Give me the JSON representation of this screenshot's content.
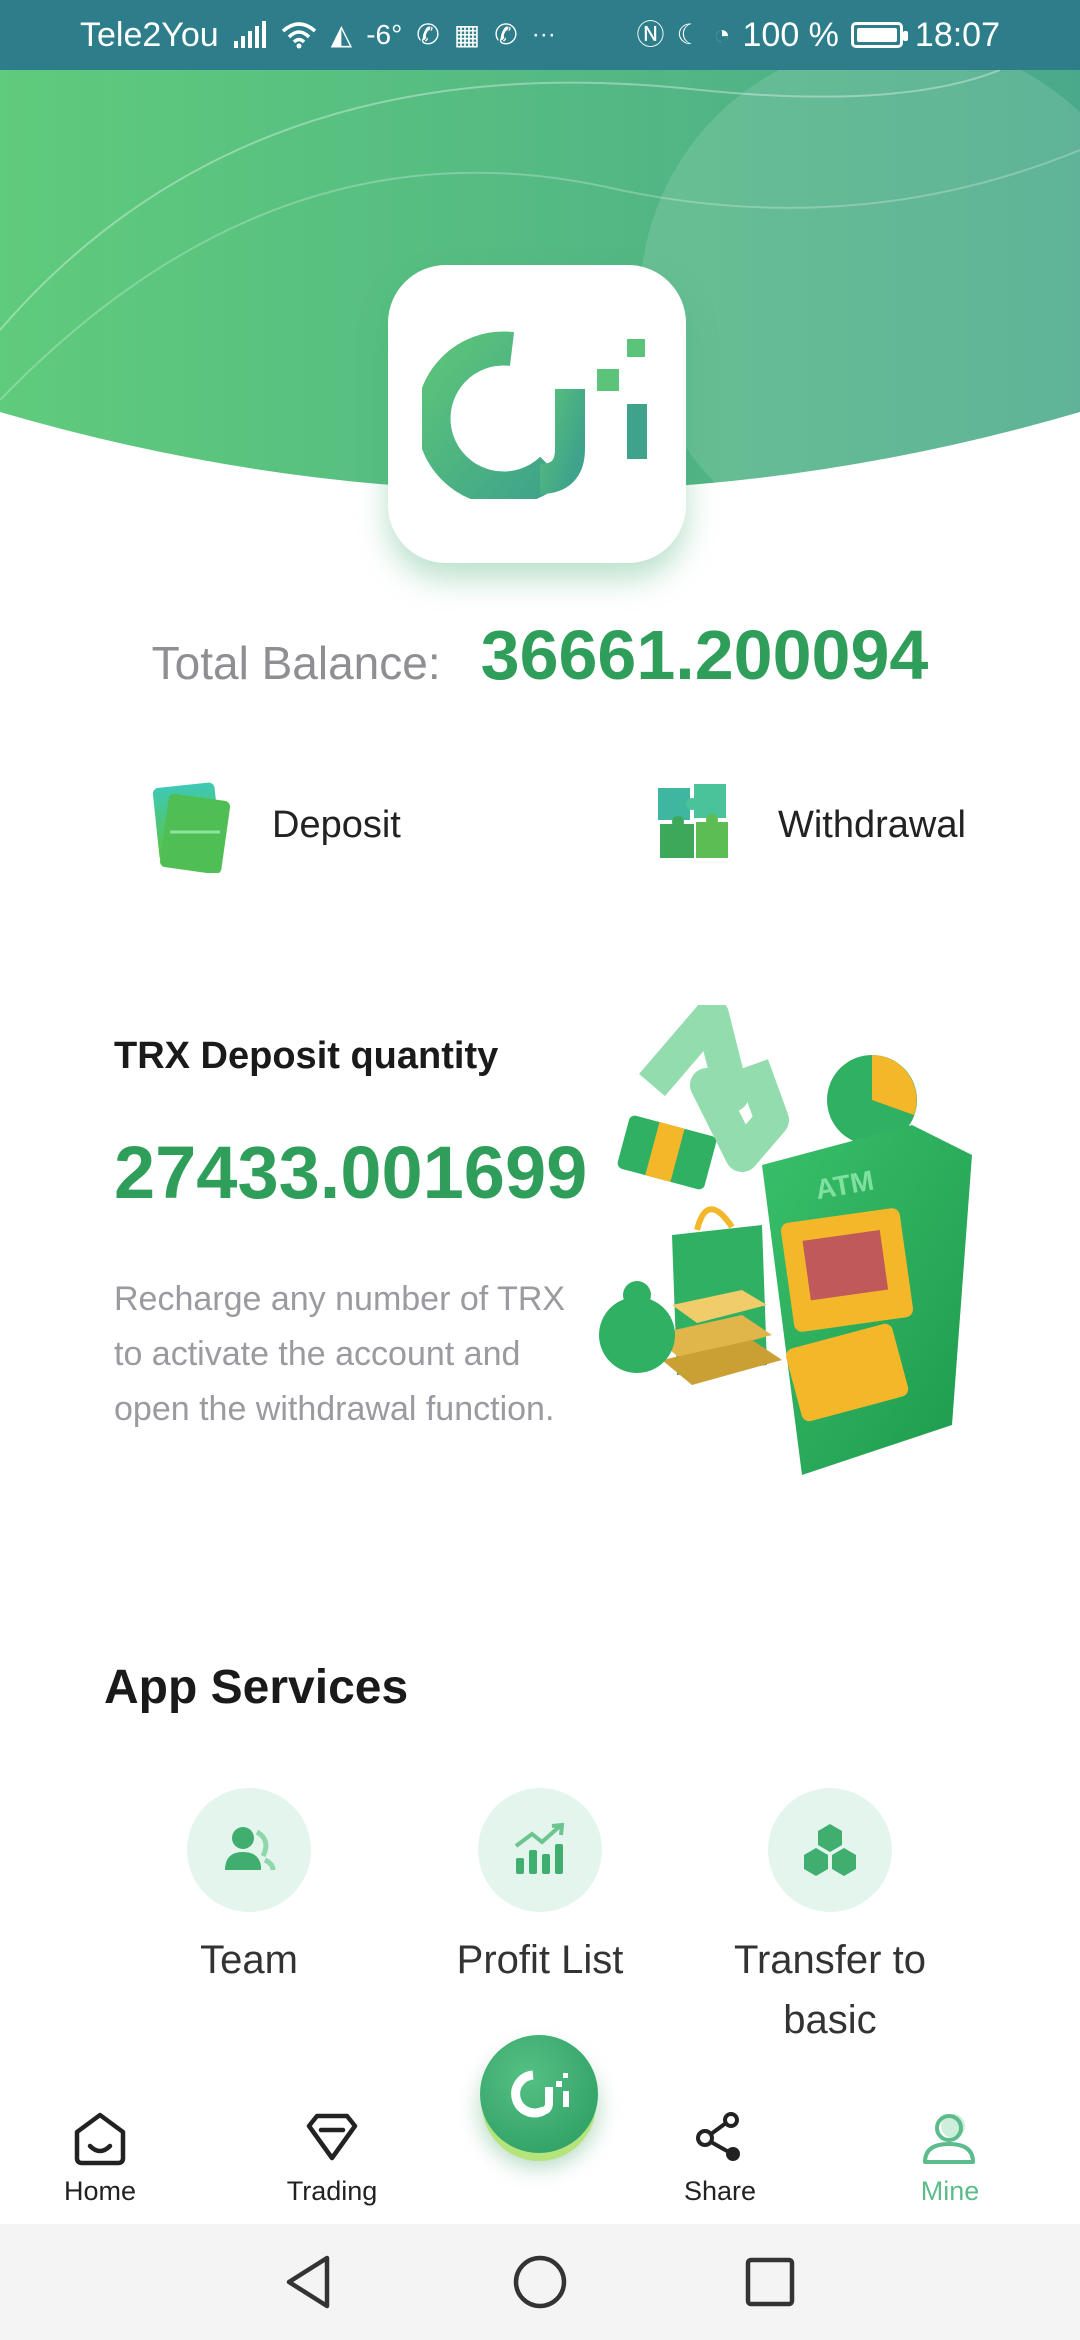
{
  "status_bar": {
    "carrier": "Tele2You",
    "temperature": "-6°",
    "battery_label": "100 %",
    "time": "18:07",
    "overflow": "···"
  },
  "balance": {
    "label": "Total Balance:",
    "value": "36661.200094"
  },
  "actions": {
    "deposit_label": "Deposit",
    "withdrawal_label": "Withdrawal"
  },
  "trx_card": {
    "title": "TRX Deposit quantity",
    "value": "27433.001699",
    "description": "Recharge any number of TRX to activate the account and open the withdrawal function.",
    "atm_text": "ATM"
  },
  "services": {
    "title": "App Services",
    "items": [
      {
        "label": "Team",
        "icon": "team-icon"
      },
      {
        "label": "Profit List",
        "icon": "bar-chart-icon"
      },
      {
        "label": "Transfer to basic",
        "icon": "cubes-icon"
      }
    ]
  },
  "bottom_nav": {
    "items": [
      {
        "label": "Home",
        "icon": "home-icon"
      },
      {
        "label": "Trading",
        "icon": "diamond-icon"
      },
      {
        "label": "Share",
        "icon": "share-icon"
      },
      {
        "label": "Mine",
        "icon": "user-icon",
        "active": true
      }
    ]
  },
  "colors": {
    "brand_green": "#2e9e5a",
    "accent_light": "#5dbb8c",
    "status_bar": "#2d7d8a"
  }
}
